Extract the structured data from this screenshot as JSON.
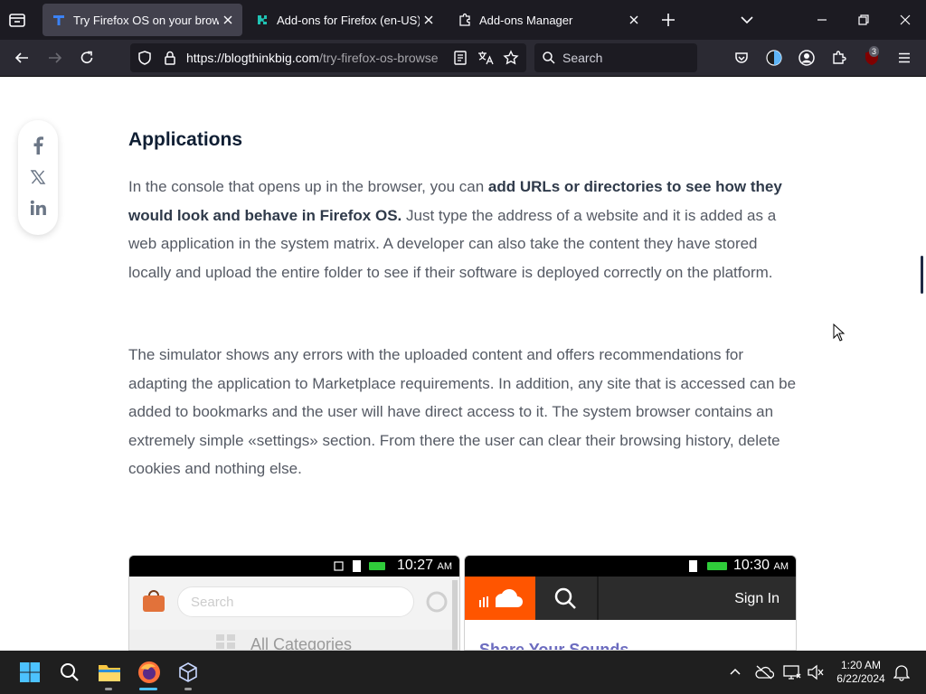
{
  "browser": {
    "tabs": [
      {
        "label": "Try Firefox OS on your browser",
        "active": true
      },
      {
        "label": "Add-ons for Firefox (en-US)",
        "active": false
      },
      {
        "label": "Add-ons Manager",
        "active": false
      }
    ],
    "url": {
      "domain": "https://blogthinkbig.com",
      "path": "/try-firefox-os-browse"
    },
    "search_placeholder": "Search",
    "extension_badge": "3"
  },
  "article": {
    "title": "Applications",
    "p1": {
      "lead": "In the console that opens up in the browser, you can ",
      "bold": "add URLs or directories to see how they would look and behave in Firefox OS.",
      "rest": " Just type the address of a website and it is added as a web application in the system matrix. A developer can also take the content they have stored locally and upload the entire folder to see if their software is deployed correctly on the platform."
    },
    "p2": "The simulator shows any errors with the uploaded content and offers recommendations for adapting the application to Marketplace requirements. In addition, any site that is accessed can be added to bookmarks and the user will have direct access to it. The system browser contains an extremely simple «settings» section. From there the user can clear their browsing history, delete cookies and nothing else."
  },
  "screenshots": {
    "left": {
      "time": "10:27",
      "ampm": "AM",
      "search_placeholder": "Search",
      "category": "All Categories"
    },
    "right": {
      "time": "10:30",
      "ampm": "AM",
      "sign_in": "Sign In",
      "heading": "Share Your Sounds"
    }
  },
  "taskbar": {
    "time": "1:20 AM",
    "date": "6/22/2024"
  },
  "colors": {
    "soundcloud_orange": "#ff5500",
    "title_navy": "#0f1e33",
    "taskbar": "#1f1f1f"
  }
}
